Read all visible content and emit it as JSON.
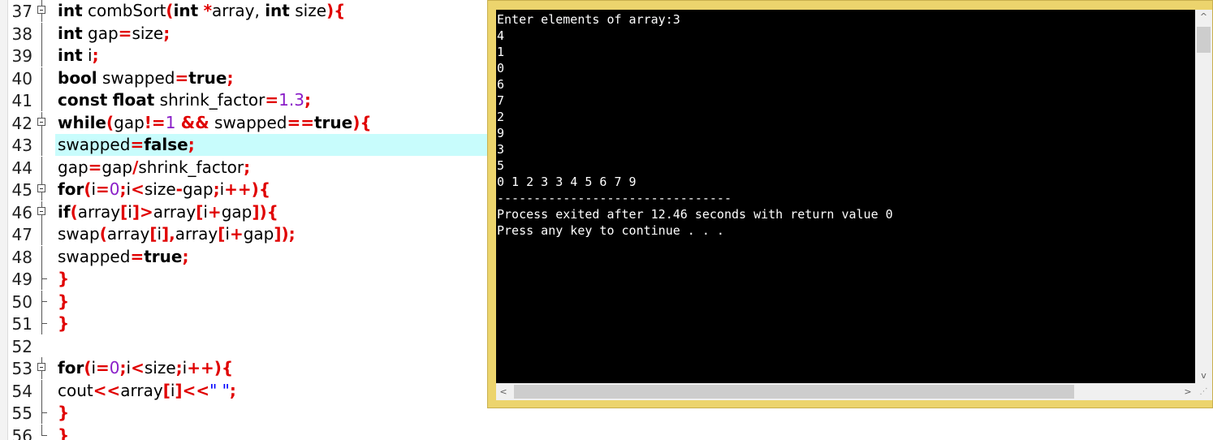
{
  "editor": {
    "highlighted_line": 43,
    "lines": [
      {
        "no": "37",
        "fold": "box",
        "tokens": [
          [
            "int",
            "kw"
          ],
          [
            " combSort",
            ""
          ],
          [
            "(",
            "op"
          ],
          [
            "int",
            "kw"
          ],
          [
            " ",
            ""
          ],
          [
            "*",
            "op"
          ],
          [
            "array, ",
            ""
          ],
          [
            "int",
            "kw"
          ],
          [
            " size",
            ""
          ],
          [
            "){",
            "op"
          ]
        ]
      },
      {
        "no": "38",
        "fold": "line",
        "tokens": [
          [
            "int",
            "kw"
          ],
          [
            " gap",
            ""
          ],
          [
            "=",
            "op"
          ],
          [
            "size",
            ""
          ],
          [
            ";",
            "op"
          ]
        ]
      },
      {
        "no": "39",
        "fold": "line",
        "tokens": [
          [
            "int",
            "kw"
          ],
          [
            " i",
            ""
          ],
          [
            ";",
            "op"
          ]
        ]
      },
      {
        "no": "40",
        "fold": "line",
        "tokens": [
          [
            "bool",
            "kw"
          ],
          [
            " swapped",
            ""
          ],
          [
            "=",
            "op"
          ],
          [
            "true",
            "kw"
          ],
          [
            ";",
            "op"
          ]
        ]
      },
      {
        "no": "41",
        "fold": "line",
        "tokens": [
          [
            "const",
            "kw"
          ],
          [
            " ",
            ""
          ],
          [
            "float",
            "kw"
          ],
          [
            " shrink_factor",
            ""
          ],
          [
            "=",
            "op"
          ],
          [
            "1.3",
            "num"
          ],
          [
            ";",
            "op"
          ]
        ]
      },
      {
        "no": "42",
        "fold": "box",
        "tokens": [
          [
            "while",
            "kw"
          ],
          [
            "(",
            "op"
          ],
          [
            "gap",
            ""
          ],
          [
            "!=",
            "op"
          ],
          [
            "1",
            "num"
          ],
          [
            " ",
            ""
          ],
          [
            "&&",
            "op"
          ],
          [
            " swapped",
            ""
          ],
          [
            "==",
            "op"
          ],
          [
            "true",
            "kw"
          ],
          [
            "){",
            "op"
          ]
        ]
      },
      {
        "no": "43",
        "fold": "line",
        "tokens": [
          [
            "swapped",
            ""
          ],
          [
            "=",
            "op"
          ],
          [
            "false",
            "kw"
          ],
          [
            ";",
            "op"
          ]
        ]
      },
      {
        "no": "44",
        "fold": "line",
        "tokens": [
          [
            "gap",
            ""
          ],
          [
            "=",
            "op"
          ],
          [
            "gap",
            ""
          ],
          [
            "/",
            "op"
          ],
          [
            "shrink_factor",
            ""
          ],
          [
            ";",
            "op"
          ]
        ]
      },
      {
        "no": "45",
        "fold": "box",
        "tokens": [
          [
            "for",
            "kw"
          ],
          [
            "(",
            "op"
          ],
          [
            "i",
            ""
          ],
          [
            "=",
            "op"
          ],
          [
            "0",
            "num"
          ],
          [
            ";",
            "op"
          ],
          [
            "i",
            ""
          ],
          [
            "<",
            "op"
          ],
          [
            "size",
            ""
          ],
          [
            "-",
            "op"
          ],
          [
            "gap",
            ""
          ],
          [
            ";",
            "op"
          ],
          [
            "i",
            ""
          ],
          [
            "++){",
            "op"
          ]
        ]
      },
      {
        "no": "46",
        "fold": "box",
        "tokens": [
          [
            "if",
            "kw"
          ],
          [
            "(",
            "op"
          ],
          [
            "array",
            ""
          ],
          [
            "[",
            "op"
          ],
          [
            "i",
            ""
          ],
          [
            "]>",
            "op"
          ],
          [
            "array",
            ""
          ],
          [
            "[",
            "op"
          ],
          [
            "i",
            ""
          ],
          [
            "+",
            "op"
          ],
          [
            "gap",
            ""
          ],
          [
            "]){",
            "op"
          ]
        ]
      },
      {
        "no": "47",
        "fold": "line",
        "tokens": [
          [
            "swap",
            ""
          ],
          [
            "(",
            "op"
          ],
          [
            "array",
            ""
          ],
          [
            "[",
            "op"
          ],
          [
            "i",
            ""
          ],
          [
            "],",
            "op"
          ],
          [
            "array",
            ""
          ],
          [
            "[",
            "op"
          ],
          [
            "i",
            ""
          ],
          [
            "+",
            "op"
          ],
          [
            "gap",
            ""
          ],
          [
            "]);",
            "op"
          ]
        ]
      },
      {
        "no": "48",
        "fold": "line",
        "tokens": [
          [
            "swapped",
            ""
          ],
          [
            "=",
            "op"
          ],
          [
            "true",
            "kw"
          ],
          [
            ";",
            "op"
          ]
        ]
      },
      {
        "no": "49",
        "fold": "end",
        "tokens": [
          [
            "}",
            "op"
          ]
        ]
      },
      {
        "no": "50",
        "fold": "end",
        "tokens": [
          [
            "}",
            "op"
          ]
        ]
      },
      {
        "no": "51",
        "fold": "end",
        "tokens": [
          [
            "}",
            "op"
          ]
        ]
      },
      {
        "no": "52",
        "fold": "none",
        "tokens": []
      },
      {
        "no": "53",
        "fold": "box",
        "tokens": [
          [
            "for",
            "kw"
          ],
          [
            "(",
            "op"
          ],
          [
            "i",
            ""
          ],
          [
            "=",
            "op"
          ],
          [
            "0",
            "num"
          ],
          [
            ";",
            "op"
          ],
          [
            "i",
            ""
          ],
          [
            "<",
            "op"
          ],
          [
            "size",
            ""
          ],
          [
            ";",
            "op"
          ],
          [
            "i",
            ""
          ],
          [
            "++){",
            "op"
          ]
        ]
      },
      {
        "no": "54",
        "fold": "line",
        "tokens": [
          [
            "cout",
            ""
          ],
          [
            "<<",
            "op"
          ],
          [
            "array",
            ""
          ],
          [
            "[",
            "op"
          ],
          [
            "i",
            ""
          ],
          [
            "]<<",
            "op"
          ],
          [
            "\" \"",
            "str"
          ],
          [
            ";",
            "op"
          ]
        ]
      },
      {
        "no": "55",
        "fold": "end",
        "tokens": [
          [
            "}",
            "op"
          ]
        ]
      },
      {
        "no": "56",
        "fold": "end",
        "tokens": [
          [
            "}",
            "op"
          ]
        ]
      }
    ]
  },
  "console": {
    "lines": [
      "Enter elements of array:3",
      "4",
      "1",
      "0",
      "6",
      "7",
      "2",
      "9",
      "3",
      "5",
      "0 1 2 3 3 4 5 6 7 9",
      "--------------------------------",
      "Process exited after 12.46 seconds with return value 0",
      "Press any key to continue . . ."
    ],
    "scroll_up_glyph": "^",
    "scroll_down_glyph": "v",
    "scroll_left_glyph": "<",
    "scroll_right_glyph": ">",
    "grip_glyph": "⋰"
  },
  "colors": {
    "keyword": "#000000",
    "operator": "#e00000",
    "number": "#8a1ec8",
    "string": "#0000ff",
    "highlight": "#c8fcfc",
    "console_frame": "#ecd46d",
    "console_bg": "#000000"
  }
}
